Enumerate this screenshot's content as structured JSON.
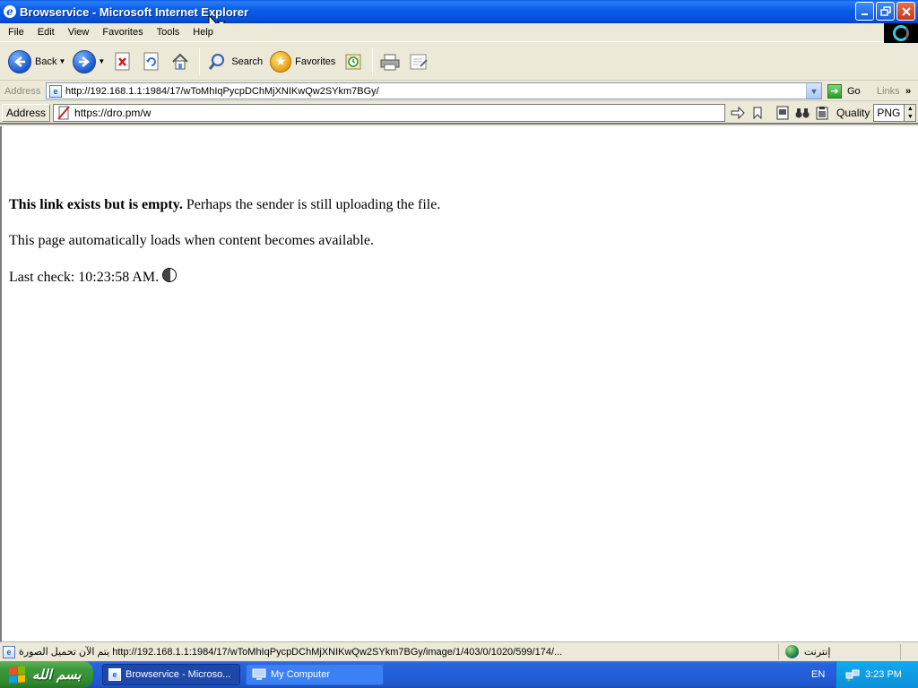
{
  "window": {
    "title": "Browservice - Microsoft Internet Explorer",
    "buttons": [
      "minimize",
      "maximize",
      "close"
    ]
  },
  "menu": {
    "items": [
      "File",
      "Edit",
      "View",
      "Favorites",
      "Tools",
      "Help"
    ]
  },
  "toolbar": {
    "back_label": "Back",
    "search_label": "Search",
    "favorites_label": "Favorites"
  },
  "address_bar": {
    "label": "Address",
    "url": "http://192.168.1.1:1984/17/wToMhIqPycpDChMjXNIKwQw2SYkm7BGy/",
    "go_label": "Go",
    "links_label": "Links"
  },
  "proxy_bar": {
    "label": "Address",
    "url": "https://dro.pm/w",
    "quality_label": "Quality",
    "quality_value": "PNG"
  },
  "page": {
    "message_bold": "This link exists but is empty.",
    "message_rest": " Perhaps the sender is still uploading the file.",
    "autoload_text": "This page automatically loads when content becomes available.",
    "last_check": "Last check: 10:23:58 AM."
  },
  "status_bar": {
    "text": "يتم الآن تحميل الصورة http://192.168.1.1:1984/17/wToMhIqPycpDChMjXNIKwQw2SYkm7BGy/image/1/403/0/1020/599/174/...",
    "zone": "إنترنت"
  },
  "taskbar": {
    "start_label": "بسم الله",
    "tasks": [
      {
        "label": "Browservice - Microso...",
        "active": true
      },
      {
        "label": "My Computer",
        "active": false
      }
    ],
    "language": "EN",
    "clock": "3:23 PM"
  },
  "colors": {
    "titlebar": "#0a5ee8",
    "taskbar": "#245edb",
    "start": "#3c9a3c",
    "tray": "#0d8fd8"
  }
}
